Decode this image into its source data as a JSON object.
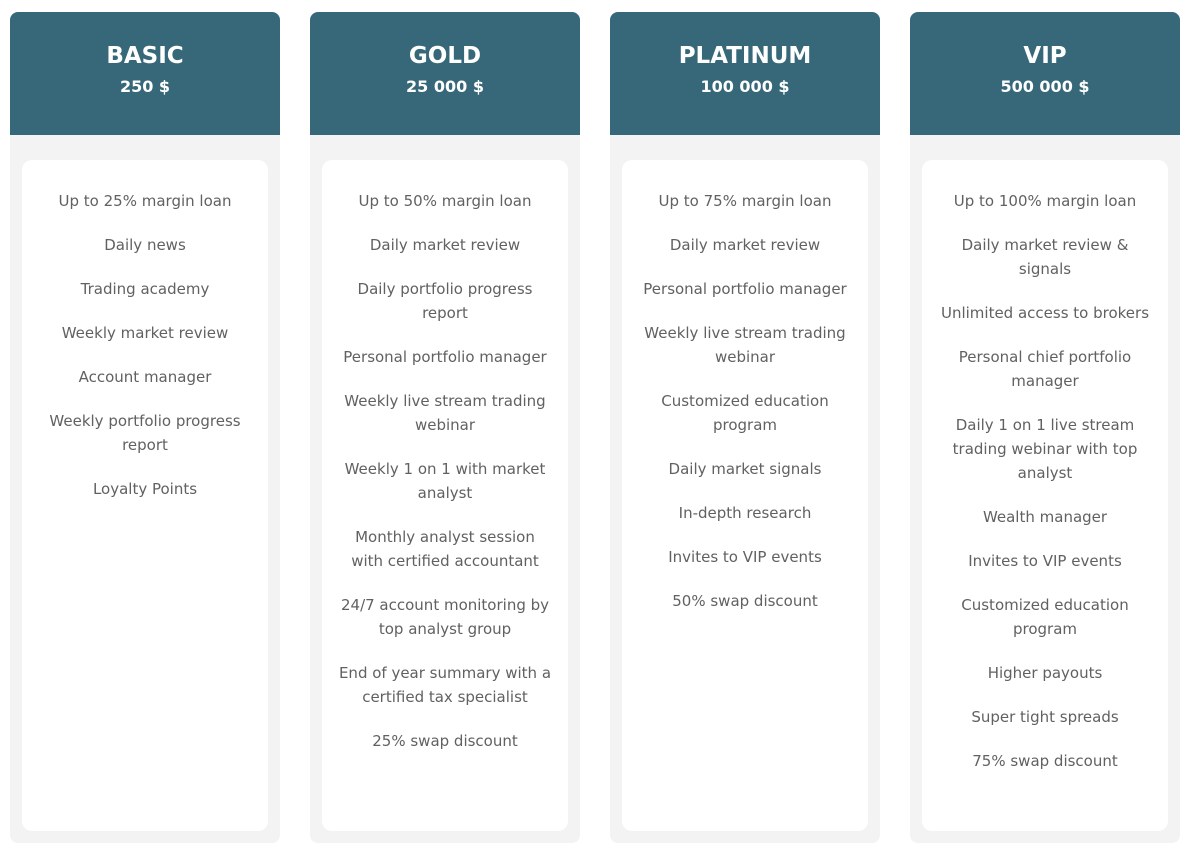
{
  "colors": {
    "header_bg": "#376879",
    "card_bg": "#f3f3f3",
    "panel_bg": "#ffffff",
    "feature_text": "#616161",
    "header_text": "#ffffff"
  },
  "plans": [
    {
      "name": "BASIC",
      "price": "250 $",
      "features": [
        "Up to 25% margin loan",
        "Daily news",
        "Trading academy",
        "Weekly market review",
        "Account manager",
        "Weekly portfolio progress report",
        "Loyalty Points"
      ]
    },
    {
      "name": "GOLD",
      "price": "25 000 $",
      "features": [
        "Up to 50% margin loan",
        "Daily market review",
        "Daily portfolio progress report",
        "Personal portfolio manager",
        "Weekly live stream trading webinar",
        "Weekly 1 on 1 with market analyst",
        "Monthly analyst session with certified accountant",
        "24/7 account monitoring by top analyst group",
        "End of year summary with a certified tax specialist",
        "25% swap discount"
      ]
    },
    {
      "name": "PLATINUM",
      "price": "100 000 $",
      "features": [
        "Up to 75% margin loan",
        "Daily market review",
        "Personal portfolio manager",
        "Weekly live stream trading webinar",
        "Customized education program",
        "Daily market signals",
        "In-depth research",
        "Invites to VIP events",
        "50% swap discount"
      ]
    },
    {
      "name": "VIP",
      "price": "500 000 $",
      "features": [
        "Up to 100% margin loan",
        "Daily market review & signals",
        "Unlimited access to brokers",
        "Personal chief portfolio manager",
        "Daily 1 on 1 live stream trading webinar with top analyst",
        "Wealth manager",
        "Invites to VIP events",
        "Customized education program",
        "Higher payouts",
        "Super tight spreads",
        "75% swap discount"
      ]
    }
  ]
}
